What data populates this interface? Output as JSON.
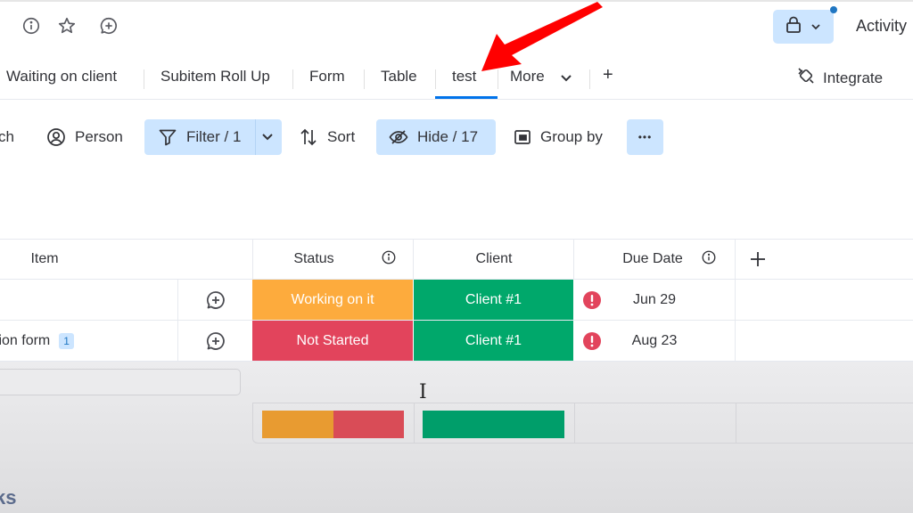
{
  "header": {
    "icons": [
      "info-icon",
      "star-icon",
      "add-update-icon"
    ],
    "lock_menu_icon": "lock-icon",
    "activity_label": "Activity"
  },
  "tabs": {
    "items": [
      {
        "label": "Waiting on client",
        "active": false
      },
      {
        "label": "Subitem Roll Up",
        "active": false
      },
      {
        "label": "Form",
        "active": false
      },
      {
        "label": "Table",
        "active": false
      },
      {
        "label": "test",
        "active": true
      },
      {
        "label": "More",
        "active": false
      }
    ],
    "add_view_label": "+",
    "integrate_label": "Integrate",
    "accent": "#0073ea"
  },
  "toolbar": {
    "search_partial": "ch",
    "person_label": "Person",
    "filter_label": "Filter / 1",
    "sort_label": "Sort",
    "hide_label": "Hide / 17",
    "group_by_label": "Group by",
    "more_label": "•••"
  },
  "table": {
    "columns": [
      {
        "label": "Item",
        "info": false
      },
      {
        "label": "Status",
        "info": true
      },
      {
        "label": "Client",
        "info": false
      },
      {
        "label": "Due Date",
        "info": true
      }
    ],
    "rows": [
      {
        "item": "",
        "subitem_count": "",
        "status": "Working on it",
        "status_color": "#fdab3d",
        "client": "Client #1",
        "client_color": "#00a86b",
        "due_warning": true,
        "due_date": "Jun 29"
      },
      {
        "item": "tion form",
        "subitem_count": "1",
        "status": "Not Started",
        "status_color": "#e2445c",
        "client": "Client #1",
        "client_color": "#00a86b",
        "due_warning": true,
        "due_date": "Aug 23"
      }
    ],
    "summary": {
      "status_distribution": [
        {
          "label": "Working on it",
          "fraction": 0.5,
          "color": "#e89b31"
        },
        {
          "label": "Not Started",
          "fraction": 0.5,
          "color": "#d94c57"
        }
      ],
      "client_distribution": [
        {
          "label": "Client #1",
          "fraction": 1.0,
          "color": "#009e6a"
        }
      ]
    }
  },
  "next_group_title_partial": "ks",
  "annotation": {
    "type": "red-arrow",
    "points_to": "test tab",
    "color": "#ff0000"
  }
}
